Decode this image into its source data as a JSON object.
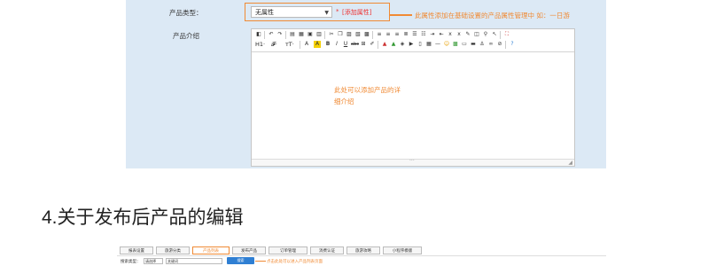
{
  "form": {
    "product_type_label": "产品类型：",
    "product_type_value": "无属性",
    "required_mark": "*",
    "add_attribute_link": "[添加属性]",
    "attribute_note": "此属性添加在基础设置的产品属性管理中 如：一日游",
    "product_intro_label": "产品介绍"
  },
  "editor": {
    "toolbar_row2_text": {
      "heading": "H1·",
      "font_family": "𝓕·",
      "font_size": "тT·"
    },
    "hint_line1": "此处可以添加产品的详",
    "hint_line2": "细介绍",
    "resize_grip": "◢",
    "status_center": "···"
  },
  "section": {
    "title": "4.关于发布后产品的编辑"
  },
  "mini_screenshot": {
    "tabs": [
      {
        "label": "报表设置"
      },
      {
        "label": "旅游分类"
      },
      {
        "label": "产品列表",
        "active": true
      },
      {
        "label": "发布产品"
      },
      {
        "label": "订单管理"
      },
      {
        "label": "消费认证"
      },
      {
        "label": "旅游攻略"
      },
      {
        "label": "小程序模版"
      }
    ],
    "search_label": "搜索类型：",
    "search_type_value": "请选择",
    "search_input_value": "关键词",
    "search_button": "搜索",
    "note": "点击此处可以进入产品列表页面"
  },
  "colors": {
    "accent": "#f08a34",
    "panel_bg": "#dce9f5",
    "button_blue": "#2f7fd3"
  }
}
